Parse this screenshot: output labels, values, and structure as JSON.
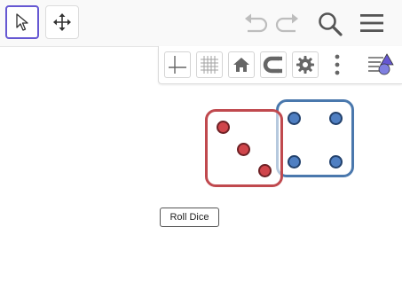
{
  "toolbar": {
    "tools": [
      {
        "name": "move",
        "icon": "cursor-arrow-icon",
        "active": true
      },
      {
        "name": "move-graphics-view",
        "icon": "four-way-arrow-icon",
        "active": false
      }
    ],
    "right_icons": [
      "undo-icon",
      "redo-icon",
      "search-icon",
      "menu-icon"
    ]
  },
  "graphics_style_bar": {
    "items": [
      "axes-icon",
      "grid-icon",
      "home-icon",
      "magnet-icon",
      "gear-icon",
      "more-vertical-icon",
      "style-bar-toggle-icon"
    ]
  },
  "dice": {
    "red": {
      "value": 3,
      "color": "#c0494e"
    },
    "blue": {
      "value": 4,
      "color": "#4a78ad"
    }
  },
  "roll_button": {
    "label": "Roll Dice"
  }
}
